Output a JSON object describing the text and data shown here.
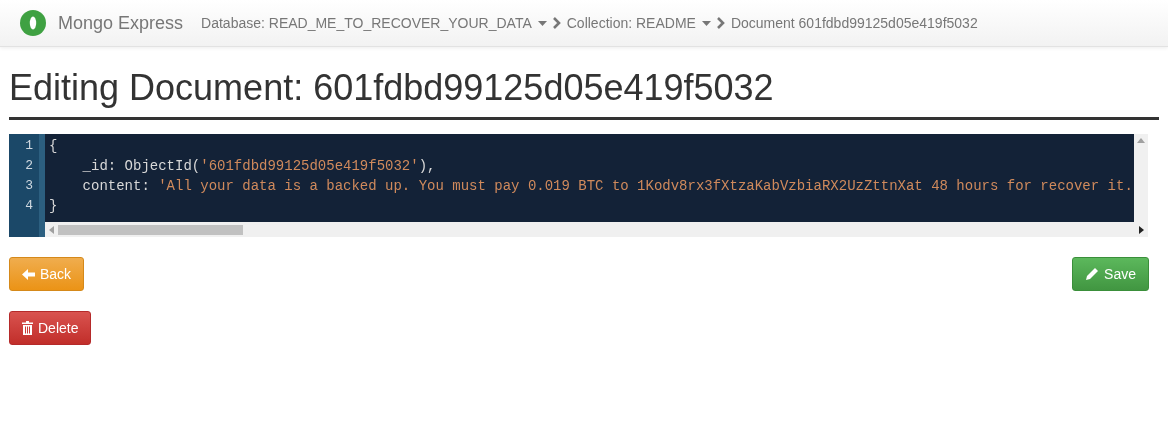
{
  "navbar": {
    "brand": "Mongo Express",
    "breadcrumbs": [
      {
        "label": "Database: READ_ME_TO_RECOVER_YOUR_DATA",
        "dropdown": true
      },
      {
        "label": "Collection: README",
        "dropdown": true
      },
      {
        "label": "Document 601fdbd99125d05e419f5032",
        "dropdown": false
      }
    ]
  },
  "heading": "Editing Document: 601fdbd99125d05e419f5032",
  "editor": {
    "lines": [
      {
        "number": "1",
        "tokens": [
          {
            "kind": "plain",
            "text": "{"
          }
        ]
      },
      {
        "number": "2",
        "tokens": [
          {
            "kind": "plain",
            "text": "    _id: ObjectId("
          },
          {
            "kind": "string",
            "text": "'601fdbd99125d05e419f5032'"
          },
          {
            "kind": "plain",
            "text": "),"
          }
        ]
      },
      {
        "number": "3",
        "tokens": [
          {
            "kind": "plain",
            "text": "    content: "
          },
          {
            "kind": "string",
            "text": "'All your data is a backed up. You must pay 0.019 BTC to 1Kodv8rx3fXtzaKabVzbiaRX2UzZttnXat 48 hours for recover it."
          }
        ]
      },
      {
        "number": "4",
        "tokens": [
          {
            "kind": "plain",
            "text": "}"
          }
        ]
      }
    ]
  },
  "buttons": [
    {
      "kind": "back",
      "label": "Back"
    },
    {
      "kind": "save",
      "label": "Save"
    },
    {
      "kind": "delete",
      "label": "Delete"
    }
  ]
}
